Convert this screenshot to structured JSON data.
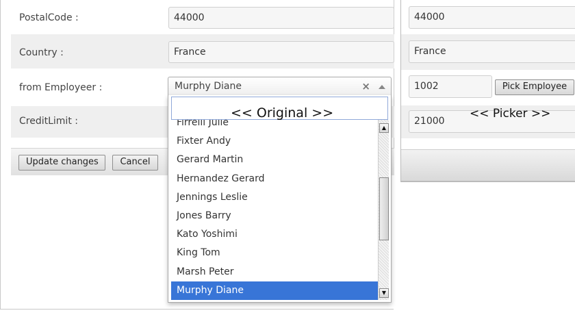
{
  "form": {
    "postal_code_label": "PostalCode :",
    "postal_code_value": "44000",
    "country_label": "Country :",
    "country_value": "France",
    "employee_label": "from Employeer :",
    "credit_limit_label": "CreditLimit :",
    "update_button": "Update changes",
    "cancel_button": "Cancel"
  },
  "combo": {
    "selected": "Murphy Diane",
    "clear_glyph": "×",
    "overlay_label": "<< Original >>",
    "options": [
      "Firrelli Julie",
      "Fixter Andy",
      "Gerard Martin",
      "Hernandez Gerard",
      "Jennings Leslie",
      "Jones Barry",
      "Kato Yoshimi",
      "King Tom",
      "Marsh Peter",
      "Murphy Diane"
    ],
    "selected_index": 9
  },
  "picker": {
    "postal_code_value": "44000",
    "country_value": "France",
    "employee_id": "1002",
    "pick_button": "Pick Employee",
    "credit_limit_value": "21000",
    "overlay_label": "<< Picker >>"
  },
  "colors": {
    "selected_option_bg": "#3875d7",
    "row_alt_bg": "#efefef"
  }
}
